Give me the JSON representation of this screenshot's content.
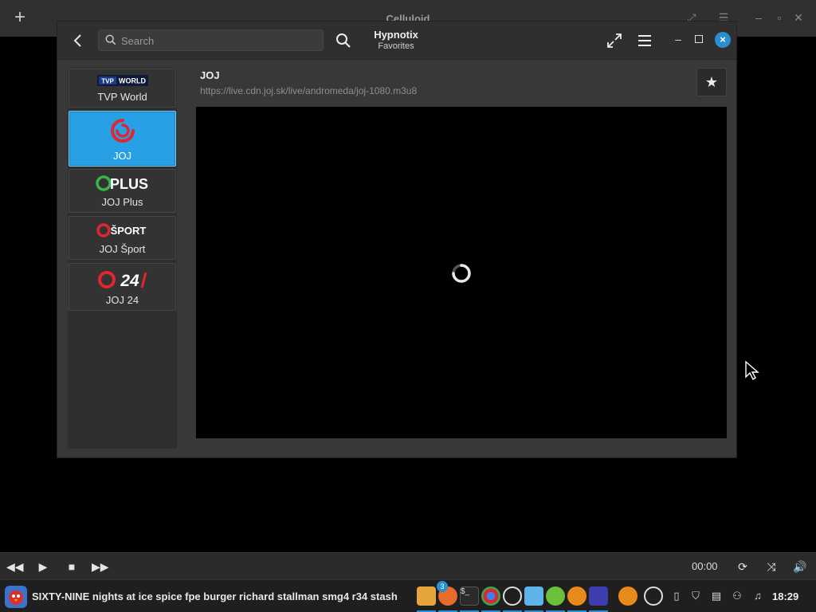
{
  "celluloid": {
    "title": "Celluloid",
    "add_icon": "plus-icon",
    "time": "00:00"
  },
  "hypnotix": {
    "title": "Hypnotix",
    "subtitle": "Favorites",
    "search_placeholder": "Search",
    "close_symbol": "×"
  },
  "channels": [
    {
      "name": "TVP World",
      "logo": "tvp-world-logo",
      "selected": false
    },
    {
      "name": "JOJ",
      "logo": "joj-logo",
      "selected": true
    },
    {
      "name": "JOJ Plus",
      "logo": "joj-plus-logo",
      "selected": false
    },
    {
      "name": "JOJ Šport",
      "logo": "joj-sport-logo",
      "selected": false
    },
    {
      "name": "JOJ 24",
      "logo": "joj-24-logo",
      "selected": false
    }
  ],
  "logos": {
    "tvp": "TVP",
    "world": "WORLD",
    "plus": "PLUS",
    "sport": "ŠPORT",
    "n24": "24"
  },
  "current": {
    "channel": "JOJ",
    "url": "https://live.cdn.joj.sk/live/andromeda/joj-1080.m3u8",
    "star": "★"
  },
  "taskbar": {
    "window_title": "SIXTY-NINE nights at ice spice fpe burger richard stallman smg4 r34 stash",
    "badge": "3",
    "clock": "18:29"
  },
  "colors": {
    "accent": "#27a0e6",
    "joj_red": "#e0262e",
    "plus_green": "#3bb54a"
  }
}
